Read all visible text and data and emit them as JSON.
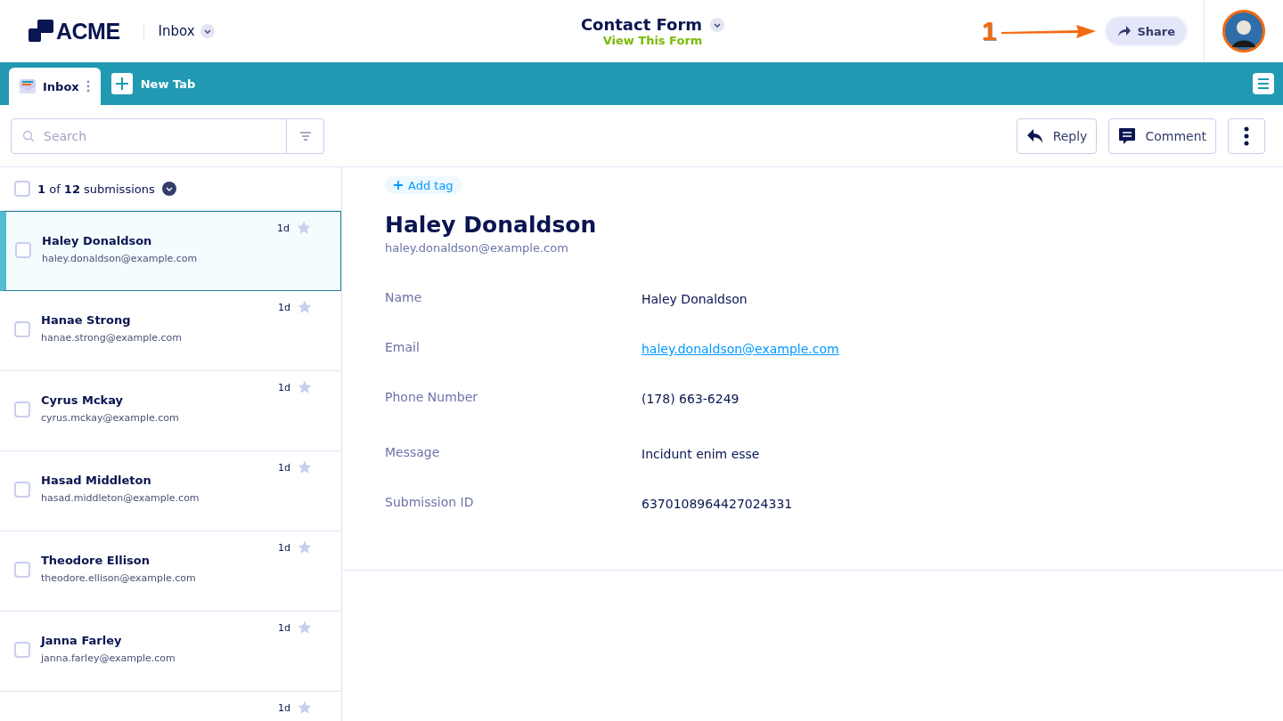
{
  "header": {
    "logo": "ACME",
    "section": "Inbox",
    "form_title": "Contact Form",
    "form_link": "View This Form",
    "callout": "1",
    "share": "Share"
  },
  "tabs": [
    {
      "label": "Inbox",
      "selected": true,
      "kind": "tab"
    },
    {
      "label": "New Tab",
      "selected": false,
      "kind": "new"
    }
  ],
  "search": {
    "placeholder": "Search"
  },
  "actions": [
    {
      "kind": "reply",
      "label": "Reply"
    },
    {
      "kind": "comment",
      "label": "Comment"
    },
    {
      "kind": "more"
    }
  ],
  "list_header": {
    "checked": false,
    "text": "**1** of **12** submissions"
  },
  "submissions": [
    {
      "name": "Haley Donaldson",
      "email": "haley.donaldson@example.com",
      "age": "1d",
      "selected": true,
      "checked": false,
      "starred": false
    },
    {
      "name": "Hanae Strong",
      "email": "hanae.strong@example.com",
      "age": "1d",
      "selected": false,
      "checked": false,
      "starred": false
    },
    {
      "name": "Cyrus Mckay",
      "email": "cyrus.mckay@example.com",
      "age": "1d",
      "selected": false,
      "checked": false,
      "starred": false
    },
    {
      "name": "Hasad Middleton",
      "email": "hasad.middleton@example.com",
      "age": "1d",
      "selected": false,
      "checked": false,
      "starred": false
    },
    {
      "name": "Theodore Ellison",
      "email": "theodore.ellison@example.com",
      "age": "1d",
      "selected": false,
      "checked": false,
      "starred": false
    },
    {
      "name": "Janna Farley",
      "email": "janna.farley@example.com",
      "age": "1d",
      "selected": false,
      "checked": false,
      "starred": false
    },
    {
      "age": "1d",
      "selected": false,
      "starred": false
    }
  ],
  "detail": {
    "add_tag": "Add tag",
    "name": "Haley Donaldson",
    "email": "haley.donaldson@example.com",
    "fields": [
      {
        "label": "Name",
        "value": "Haley Donaldson",
        "kind": "text"
      },
      {
        "label": "Email",
        "value": "haley.donaldson@example.com",
        "kind": "link"
      },
      {
        "label": "Phone Number",
        "value": "(178) 663-6249",
        "kind": "text"
      },
      {
        "label": "Message",
        "value": "Incidunt enim esse",
        "kind": "text"
      },
      {
        "label": "Submission ID",
        "value": "6370108964427024331",
        "kind": "text"
      }
    ]
  }
}
